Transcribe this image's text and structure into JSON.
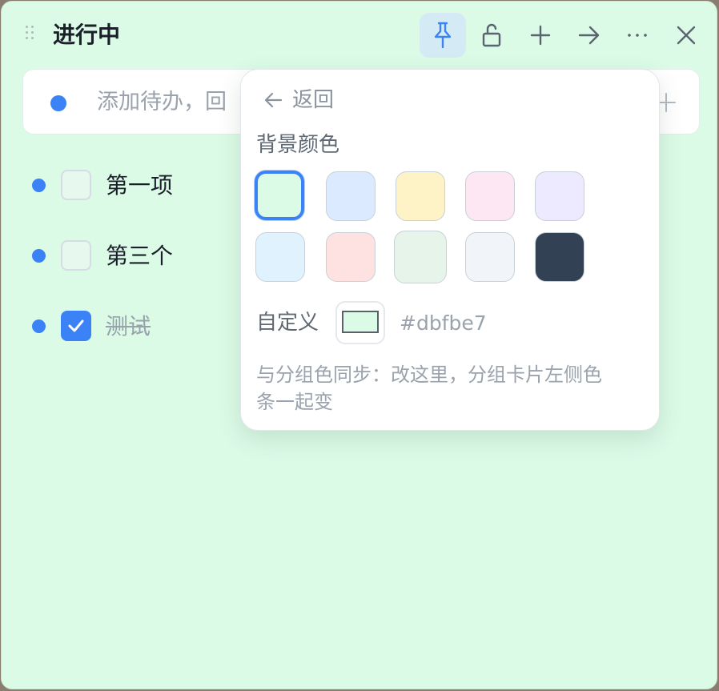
{
  "header": {
    "title": "进行中"
  },
  "add_bar": {
    "placeholder": "添加待办，回"
  },
  "todos": [
    {
      "label": "第一项",
      "checked": false
    },
    {
      "label": "第三个",
      "checked": false
    },
    {
      "label": "测试",
      "checked": true
    }
  ],
  "popover": {
    "back_label": "返回",
    "section_title": "背景颜色",
    "swatches": [
      "#dbfbe7",
      "#dbeafe",
      "#fef3c7",
      "#fce7f3",
      "#ede9fe",
      "#e0f2fe",
      "#fee2e2",
      "#e6f4ea",
      "#f1f5f9",
      "#334155"
    ],
    "selected_swatch": "#dbfbe7",
    "custom_label": "自定义",
    "custom_value": "#dbfbe7",
    "hint": "与分组色同步：改这里，分组卡片左侧色条一起变"
  },
  "colors": {
    "background": "#dbfbe7",
    "accent": "#3b82f6"
  }
}
